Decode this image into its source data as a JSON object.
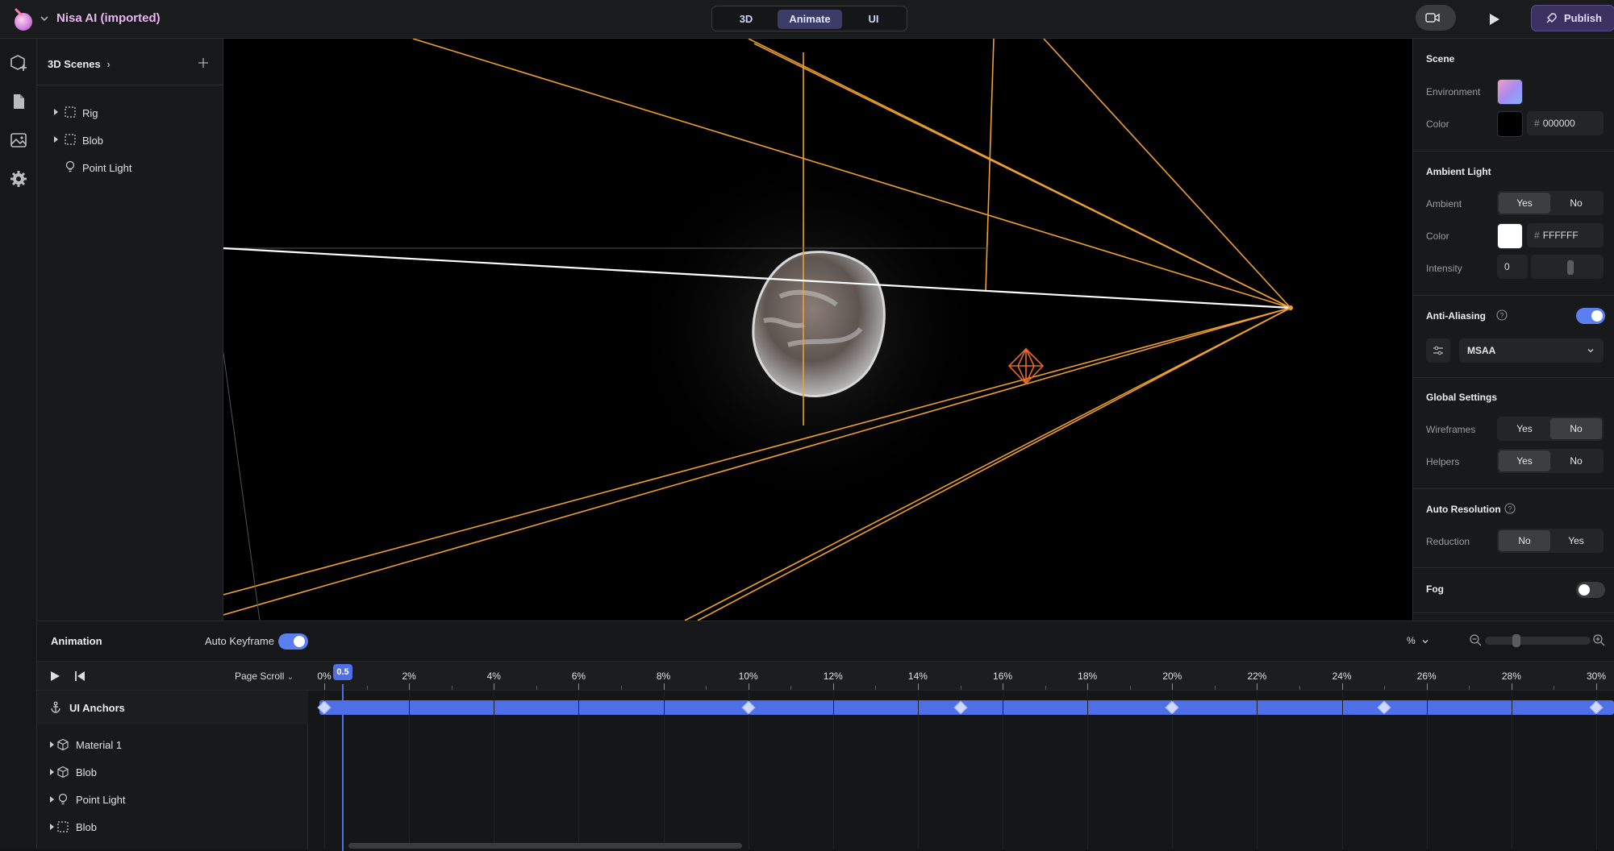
{
  "app": {
    "project_name": "Nisa AI (imported)"
  },
  "topbar": {
    "modes": [
      "3D",
      "Animate",
      "UI"
    ],
    "active_mode": "Animate",
    "publish_label": "Publish"
  },
  "left_panel": {
    "title": "3D Scenes",
    "items": [
      {
        "label": "Rig",
        "icon": "bounding-box-icon",
        "expandable": true
      },
      {
        "label": "Blob",
        "icon": "bounding-box-icon",
        "expandable": true
      },
      {
        "label": "Point Light",
        "icon": "lightbulb-icon",
        "expandable": false
      }
    ]
  },
  "right_panel": {
    "scene": {
      "title": "Scene",
      "environment_label": "Environment",
      "color_label": "Color",
      "color_hex": "000000"
    },
    "ambient": {
      "title": "Ambient Light",
      "ambient_label": "Ambient",
      "ambient_options": [
        "Yes",
        "No"
      ],
      "ambient_selected": "Yes",
      "color_label": "Color",
      "color_hex": "FFFFFF",
      "intensity_label": "Intensity",
      "intensity_value": "0"
    },
    "anti_aliasing": {
      "title": "Anti-Aliasing",
      "enabled": true,
      "mode": "MSAA"
    },
    "global": {
      "title": "Global Settings",
      "wireframes_label": "Wireframes",
      "wireframes_options": [
        "Yes",
        "No"
      ],
      "wireframes_selected": "No",
      "helpers_label": "Helpers",
      "helpers_options": [
        "Yes",
        "No"
      ],
      "helpers_selected": "Yes"
    },
    "auto_resolution": {
      "title": "Auto Resolution",
      "reduction_label": "Reduction",
      "reduction_options": [
        "No",
        "Yes"
      ],
      "reduction_selected": "No"
    },
    "fog": {
      "title": "Fog",
      "enabled": false
    }
  },
  "animation": {
    "title": "Animation",
    "auto_keyframe_label": "Auto Keyframe",
    "auto_keyframe_on": true,
    "unit": "%",
    "trigger": "Page Scroll",
    "playhead_label": "0.5",
    "ruler_labels": [
      "0%",
      "2%",
      "4%",
      "6%",
      "8%",
      "10%",
      "12%",
      "14%",
      "16%",
      "18%",
      "20%",
      "22%",
      "24%",
      "26%",
      "28%",
      "30%"
    ],
    "anchors_label": "UI Anchors",
    "keyframes_percent": [
      0,
      10,
      15,
      20,
      25,
      30
    ],
    "tracks": [
      {
        "label": "Material 1",
        "icon": "cube-icon"
      },
      {
        "label": "Blob",
        "icon": "cube-icon"
      },
      {
        "label": "Point Light",
        "icon": "lightbulb-icon"
      },
      {
        "label": "Blob",
        "icon": "bounding-box-icon"
      }
    ]
  },
  "colors": {
    "accent": "#4e6fe6",
    "helper_orange": "#f0a030",
    "publish_bg": "#3b3262"
  }
}
